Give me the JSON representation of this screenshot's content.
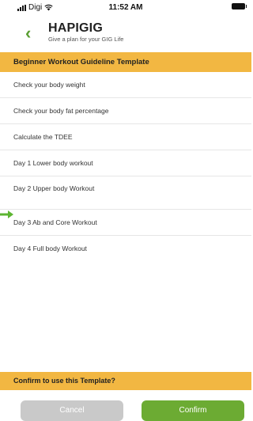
{
  "status_bar": {
    "carrier": "Digi",
    "time": "11:52 AM"
  },
  "header": {
    "title": "HAPIGIG",
    "subtitle": "Give a plan for your GIG Life"
  },
  "section": {
    "title": "Beginner Workout Guideline Template"
  },
  "items": [
    {
      "label": "Check your body weight"
    },
    {
      "label": "Check your body fat percentage"
    },
    {
      "label": "Calculate the TDEE"
    },
    {
      "label": "Day 1 Lower body workout"
    },
    {
      "label": "Day 2 Upper body Workout"
    },
    {
      "label": "Day 3 Ab and Core Workout"
    },
    {
      "label": "Day 4 Full body Workout"
    }
  ],
  "confirm": {
    "question": "Confirm to use this Template?",
    "cancel_label": "Cancel",
    "confirm_label": "Confirm"
  },
  "colors": {
    "accent_orange": "#f2b742",
    "accent_green": "#6cab33",
    "cancel_gray": "#c9c9c9"
  },
  "icons": [
    "signal-icon",
    "wifi-icon",
    "battery-icon",
    "back-chevron-icon",
    "arrow-right-icon"
  ]
}
